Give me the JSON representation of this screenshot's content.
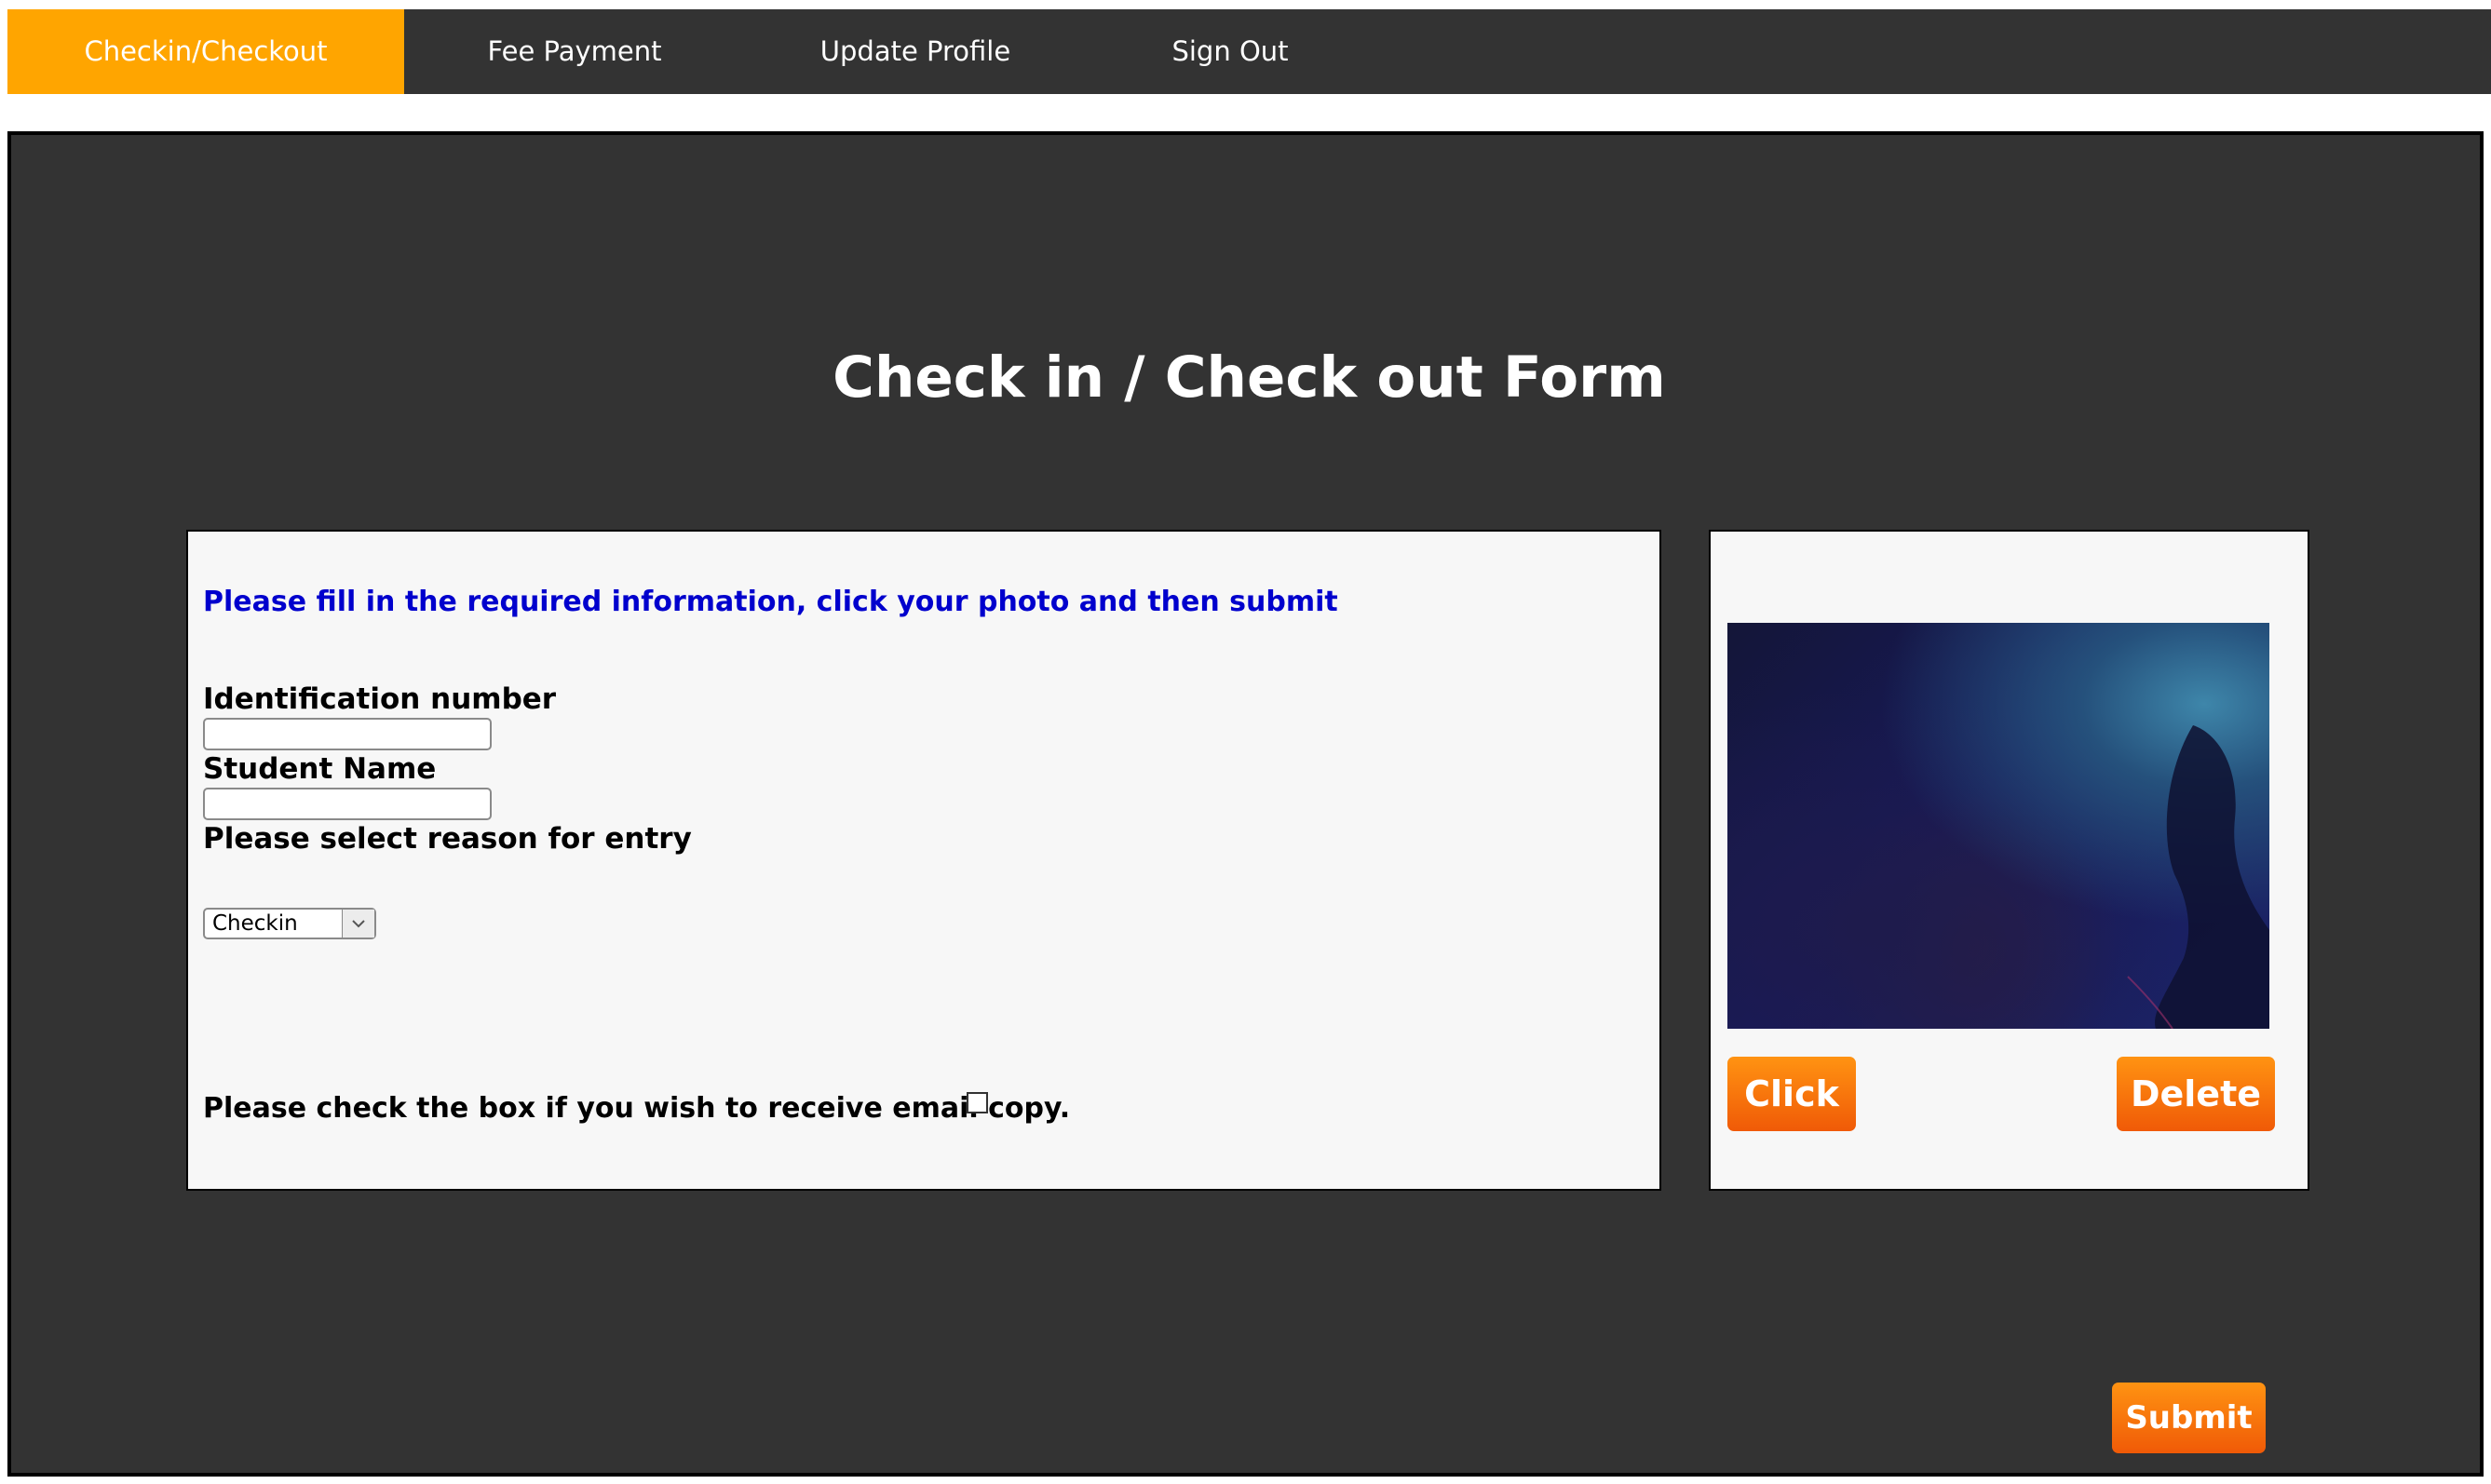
{
  "nav": {
    "items": [
      {
        "label": "Checkin/Checkout",
        "active": true
      },
      {
        "label": "Fee Payment",
        "active": false
      },
      {
        "label": "Update Profile",
        "active": false
      },
      {
        "label": "Sign Out",
        "active": false
      }
    ]
  },
  "main": {
    "title": "Check in / Check out Form"
  },
  "form": {
    "instructions": "Please fill in the required information, click your photo and then submit",
    "id_label": "Identification number",
    "id_value": "",
    "name_label": "Student Name",
    "name_value": "",
    "reason_label": "Please select reason for entry",
    "reason_selected": "Checkin",
    "email_label": "Please check the box if you wish to receive email copy.",
    "email_checked": false
  },
  "photo": {
    "click_label": "Click",
    "delete_label": "Delete"
  },
  "submit_label": "Submit",
  "colors": {
    "nav_bg": "#333333",
    "nav_active": "#ffa500",
    "panel_bg": "#f7f7f7",
    "instruction_text": "#0000cd",
    "button_top": "#ff9312",
    "button_bottom": "#f05a07"
  },
  "icons": {
    "select_arrow": "chevron-down-icon"
  }
}
